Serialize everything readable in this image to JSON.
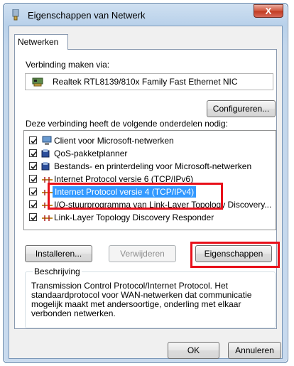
{
  "window": {
    "title": "Eigenschappen van Netwerk",
    "close_label": "X"
  },
  "tabs": [
    {
      "label": "Netwerken"
    }
  ],
  "connect": {
    "label": "Verbinding maken via:",
    "adapter": "Realtek RTL8139/810x Family Fast Ethernet NIC",
    "configure_label": "Configureren..."
  },
  "components": {
    "label": "Deze verbinding heeft de volgende onderdelen nodig:",
    "items": [
      {
        "label": "Client voor Microsoft-netwerken",
        "checked": true,
        "icon": "network-client-icon"
      },
      {
        "label": "QoS-pakketplanner",
        "checked": true,
        "icon": "service-icon"
      },
      {
        "label": "Bestands- en printerdeling voor Microsoft-netwerken",
        "checked": true,
        "icon": "service-icon"
      },
      {
        "label": "Internet Protocol versie 6 (TCP/IPv6)",
        "checked": true,
        "icon": "protocol-icon"
      },
      {
        "label": "Internet Protocol versie 4 (TCP/IPv4)",
        "checked": true,
        "icon": "protocol-icon",
        "selected": true
      },
      {
        "label": "I/O-stuurprogramma van Link-Layer Topology Discovery...",
        "checked": true,
        "icon": "protocol-icon"
      },
      {
        "label": "Link-Layer Topology Discovery Responder",
        "checked": true,
        "icon": "protocol-icon"
      }
    ]
  },
  "buttons": {
    "install": "Installeren...",
    "remove": "Verwijderen",
    "properties": "Eigenschappen",
    "ok": "OK",
    "cancel": "Annuleren"
  },
  "description": {
    "legend": "Beschrijving",
    "text": "Transmission Control Protocol/Internet Protocol. Het standaardprotocol voor WAN-netwerken dat communicatie mogelijk maakt met andersoortige, onderling met elkaar verbonden netwerken."
  },
  "colors": {
    "highlight": "#e8101a",
    "selection": "#3399ff"
  }
}
